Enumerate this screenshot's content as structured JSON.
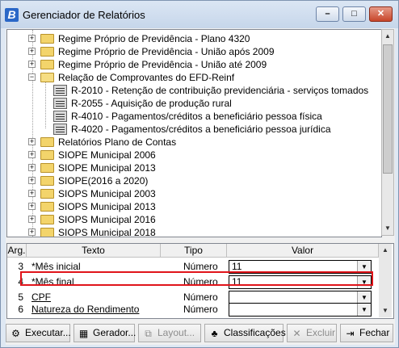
{
  "window": {
    "title": "Gerenciador de Relatórios",
    "app_icon": "B",
    "controls": [
      "minimize",
      "maximize",
      "close"
    ]
  },
  "tree": {
    "items": [
      {
        "label": "Regime Próprio de Previdência - Plano 4320",
        "icon": "folder-icon",
        "expander": "+"
      },
      {
        "label": "Regime Próprio de Previdência - União após 2009",
        "icon": "folder-icon",
        "expander": "+"
      },
      {
        "label": "Regime Próprio de Previdência - União até 2009",
        "icon": "folder-icon",
        "expander": "+"
      },
      {
        "label": "Relação de Comprovantes do EFD-Reinf",
        "icon": "open-folder-icon",
        "expander": "−"
      },
      {
        "label": "R-2010 - Retenção de contribuição previdenciária - serviços tomados",
        "icon": "report-icon"
      },
      {
        "label": "R-2055 - Aquisição de produção rural",
        "icon": "report-icon"
      },
      {
        "label": "R-4010 - Pagamentos/créditos a beneficiário pessoa física",
        "icon": "report-icon"
      },
      {
        "label": "R-4020 - Pagamentos/créditos a beneficiário pessoa jurídica",
        "icon": "report-icon"
      },
      {
        "label": "Relatórios Plano de Contas",
        "icon": "folder-icon",
        "expander": "+"
      },
      {
        "label": "SIOPE Municipal 2006",
        "icon": "folder-icon",
        "expander": "+"
      },
      {
        "label": "SIOPE Municipal 2013",
        "icon": "folder-icon",
        "expander": "+"
      },
      {
        "label": "SIOPE(2016 a 2020)",
        "icon": "folder-icon",
        "expander": "+"
      },
      {
        "label": "SIOPS Municipal 2003",
        "icon": "folder-icon",
        "expander": "+"
      },
      {
        "label": "SIOPS Municipal 2013",
        "icon": "folder-icon",
        "expander": "+"
      },
      {
        "label": "SIOPS Municipal 2016",
        "icon": "folder-icon",
        "expander": "+"
      },
      {
        "label": "SIOPS Municipal 2018",
        "icon": "folder-icon",
        "expander": "+"
      }
    ]
  },
  "grid": {
    "headers": [
      "Arg.",
      "Texto",
      "Tipo",
      "Valor"
    ],
    "rows": [
      {
        "arg": "3",
        "texto": "*Mês inicial",
        "tipo": "Número",
        "valor": "11"
      },
      {
        "arg": "4",
        "texto": "*Mês final",
        "tipo": "Número",
        "valor": "11"
      },
      {
        "arg": "5",
        "texto": "CPF",
        "tipo": "Número",
        "valor": ""
      },
      {
        "arg": "6",
        "texto": "Natureza do Rendimento",
        "tipo": "Número",
        "valor": ""
      }
    ]
  },
  "buttons": {
    "executar": "Executar...",
    "gerador": "Gerador...",
    "layout": "Layout...",
    "classificacoes": "Classificações",
    "excluir": "Excluir",
    "fechar": "Fechar"
  },
  "colors": {
    "highlight": "#e0141a",
    "title_bg": "#c6d6ea"
  }
}
